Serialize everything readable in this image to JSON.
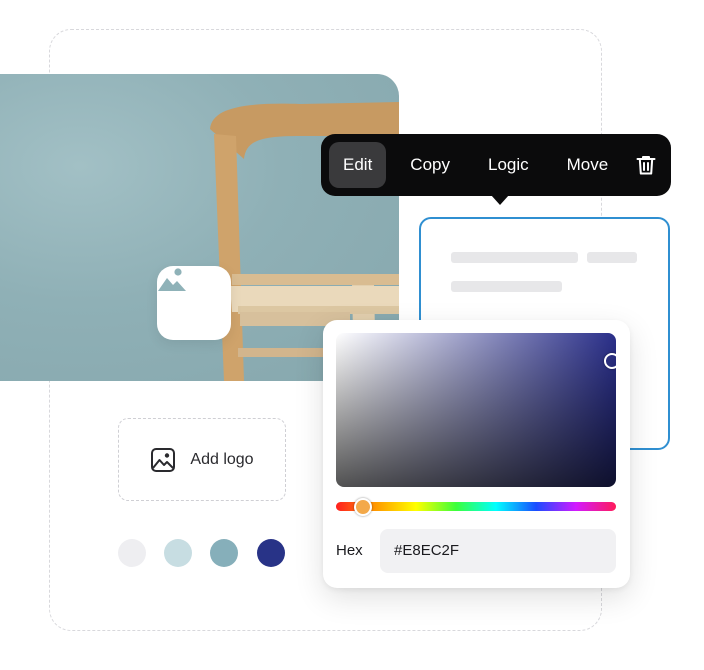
{
  "toolbar": {
    "items": [
      {
        "label": "Edit",
        "active": true
      },
      {
        "label": "Copy"
      },
      {
        "label": "Logic"
      },
      {
        "label": "Move"
      }
    ],
    "trash_icon": "trash-icon"
  },
  "image_block": {
    "placeholder_icon": "image-icon"
  },
  "logo": {
    "label": "Add logo",
    "icon": "image-icon"
  },
  "swatches": [
    "#eeeef1",
    "#c7dde2",
    "#86afba",
    "#283387"
  ],
  "color_picker": {
    "hex_label": "Hex",
    "hex_value": "#E8EC2F"
  },
  "colors": {
    "selection_border": "#2f8fd1",
    "toolbar_bg": "#0b0b0c"
  }
}
